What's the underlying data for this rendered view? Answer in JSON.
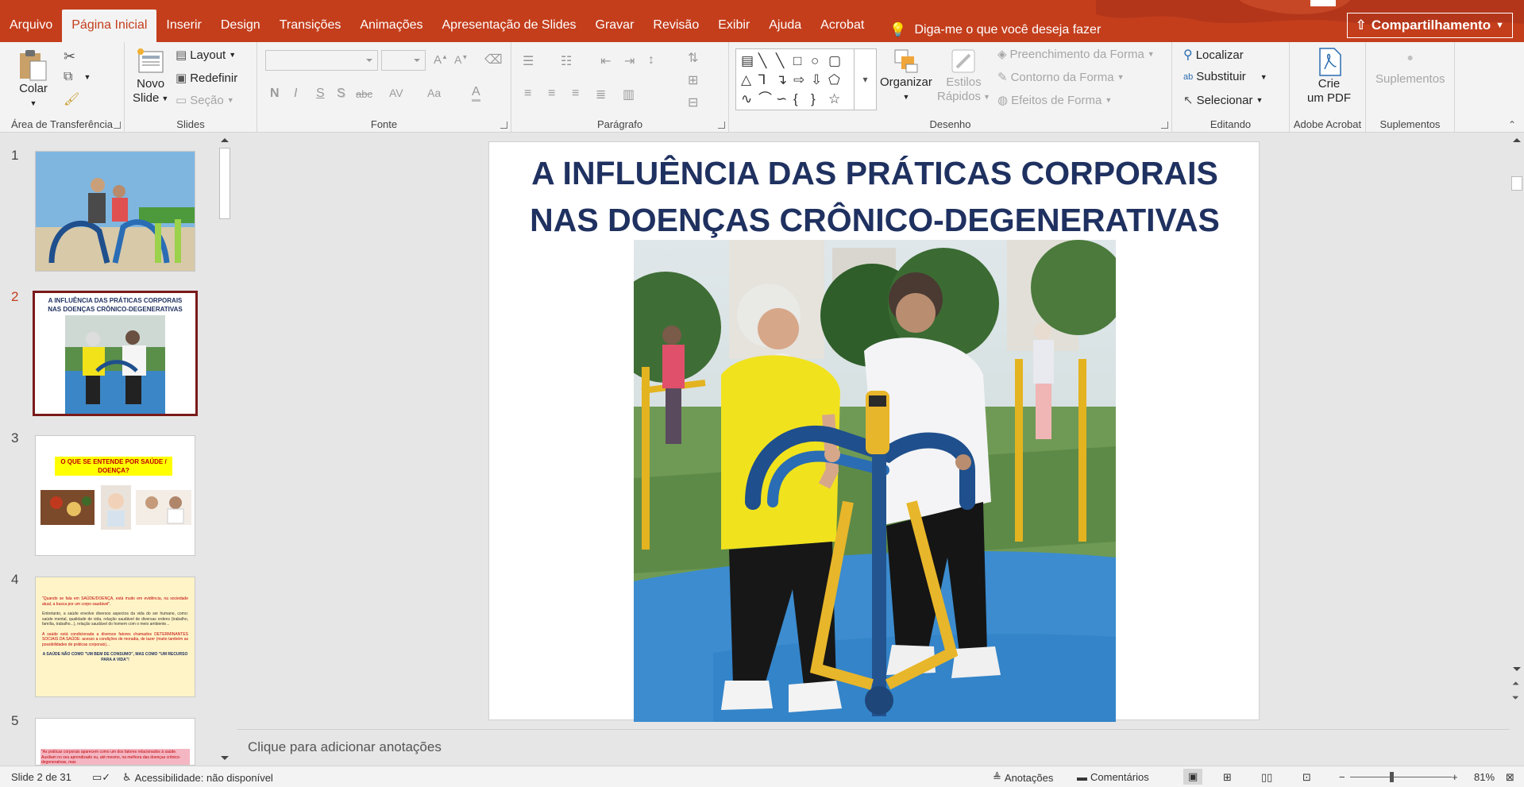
{
  "tabs": [
    "Arquivo",
    "Página Inicial",
    "Inserir",
    "Design",
    "Transições",
    "Animações",
    "Apresentação de Slides",
    "Gravar",
    "Revisão",
    "Exibir",
    "Ajuda",
    "Acrobat"
  ],
  "active_tab_index": 1,
  "tell_me": "Diga-me o que você deseja fazer",
  "share_label": "Compartilhamento",
  "ribbon": {
    "clipboard": {
      "label": "Área de Transferência",
      "paste": "Colar"
    },
    "slides": {
      "label": "Slides",
      "new_slide_1": "Novo",
      "new_slide_2": "Slide",
      "layout": "Layout",
      "reset": "Redefinir",
      "section": "Seção"
    },
    "font": {
      "label": "Fonte",
      "bold": "N",
      "italic": "I",
      "underline": "S",
      "shadow": "S",
      "strike": "abc",
      "spacing": "AV",
      "case": "Aa",
      "color": "A"
    },
    "paragraph": {
      "label": "Parágrafo"
    },
    "drawing": {
      "label": "Desenho",
      "arrange": "Organizar",
      "quick_styles_1": "Estilos",
      "quick_styles_2": "Rápidos",
      "shape_fill": "Preenchimento da Forma",
      "shape_outline": "Contorno da Forma",
      "shape_effects": "Efeitos de Forma"
    },
    "editing": {
      "label": "Editando",
      "find": "Localizar",
      "replace": "Substituir",
      "select": "Selecionar"
    },
    "acrobat": {
      "label": "Adobe Acrobat",
      "create_1": "Crie",
      "create_2": "um PDF"
    },
    "addins": {
      "label": "Suplementos",
      "button": "Suplementos"
    }
  },
  "thumbnails": [
    {
      "num": "1"
    },
    {
      "num": "2",
      "title": "A INFLUÊNCIA DAS PRÁTICAS CORPORAIS NAS DOENÇAS CRÔNICO-DEGENERATIVAS"
    },
    {
      "num": "3",
      "title": "O QUE SE ENTENDE POR SAÚDE / DOENÇA?"
    },
    {
      "num": "4",
      "lines": [
        "\"Quando se fala em SAÚDE/DOENÇA, está muito em evidência, na sociedade atual, a busca por um corpo saudável\".",
        "Entretanto, a saúde envolve diversos aspectos da vida do ser humano, como: saúde mental, qualidade de vida, relação saudável de diversas ordens (trabalho, família, trabalho...), relação saudável do homem com o meio ambiente...",
        "A saúde está condicionada a diversos fatores chamados DETERMINANTES SOCIAIS DA SAÚDE: acesso a condições de moradia, de lazer (muito também as possibilidades de práticas corporais)...",
        "A SAÚDE NÃO COMO \"UM BEM DE CONSUMO\", MAS COMO \"UM RECURSO PARA A VIDA\"!"
      ]
    },
    {
      "num": "5",
      "lines": [
        "\"As práticas corporais aparecem como um dos fatores relacionados à saúde. Auxiliam no seu aprendizado ou, até mesmo, na melhora das doenças crônico-degenerativas, mas"
      ]
    }
  ],
  "slide": {
    "title_line1": "A INFLUÊNCIA DAS PRÁTICAS CORPORAIS",
    "title_line2": "NAS DOENÇAS CRÔNICO-DEGENERATIVAS"
  },
  "notes_placeholder": "Clique para adicionar anotações",
  "status": {
    "slide_info": "Slide 2 de 31",
    "accessibility": "Acessibilidade: não disponível",
    "notes": "Anotações",
    "comments": "Comentários",
    "zoom": "81%",
    "zoom_level": 0.81
  },
  "colors": {
    "accent": "#c43e1c",
    "title": "#1f3160",
    "selected_thumb": "#7a1a1a"
  }
}
